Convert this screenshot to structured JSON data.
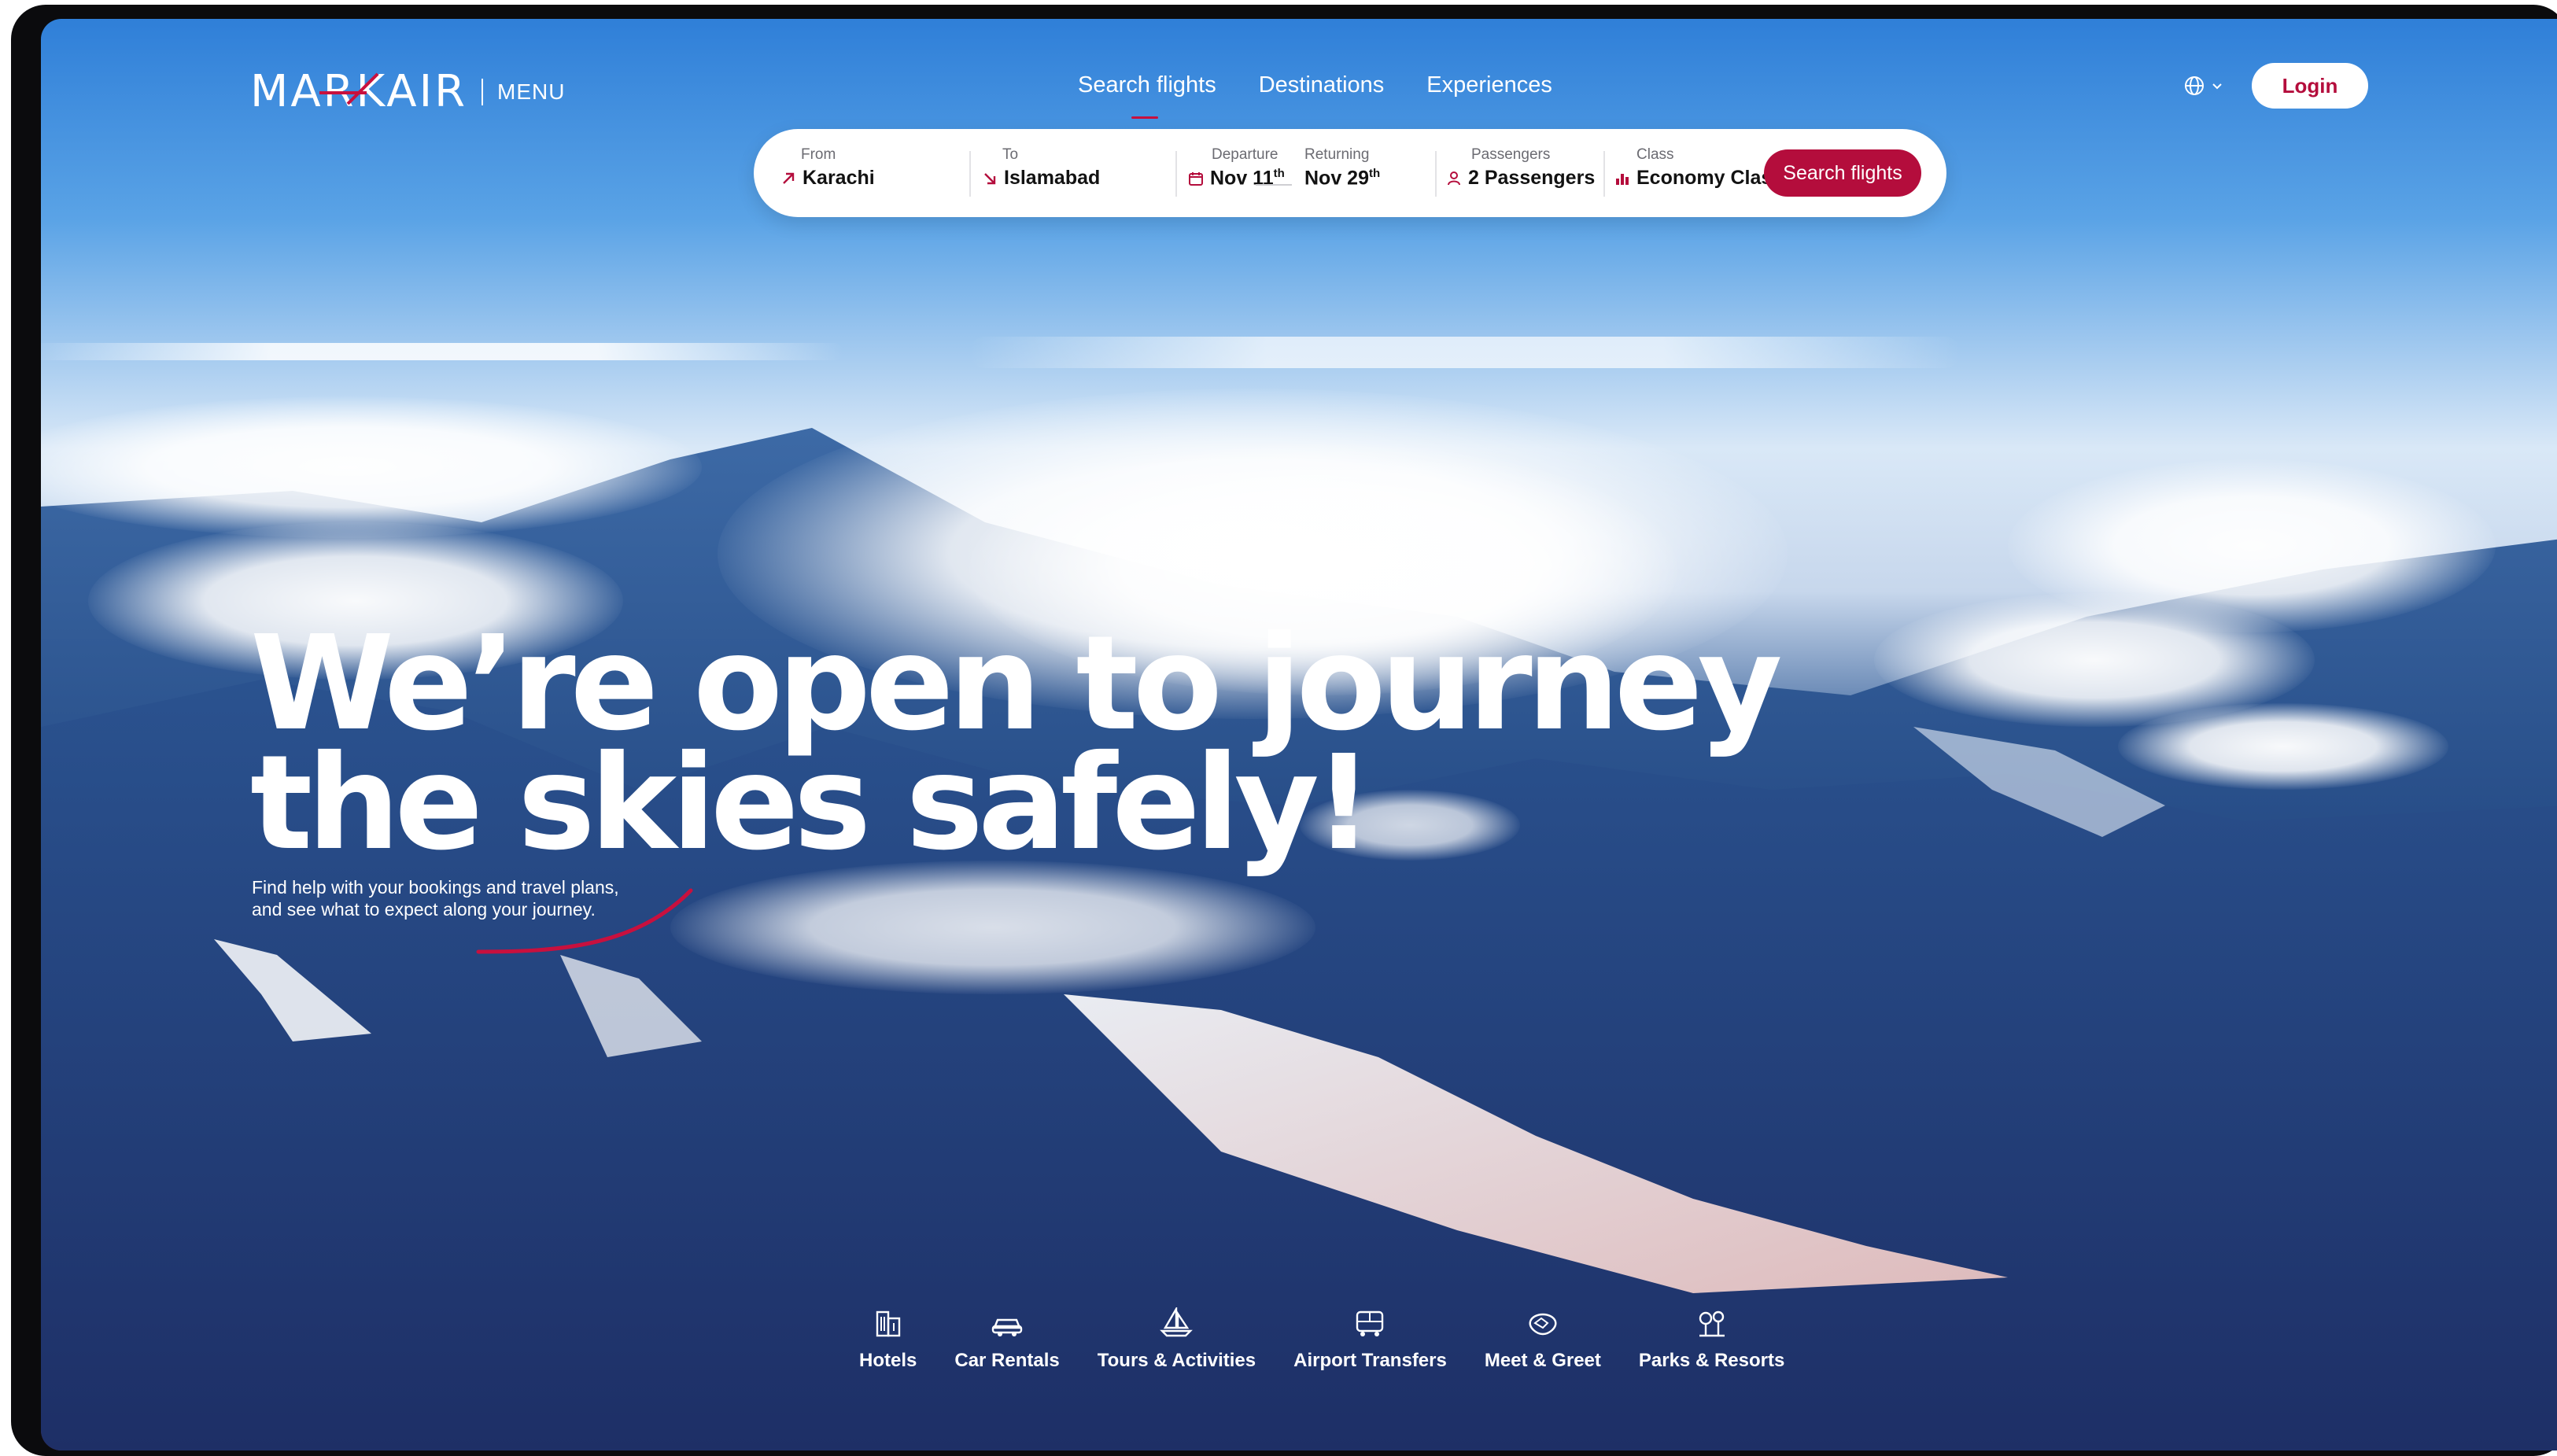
{
  "brand": {
    "logo_text": "MARKAIR",
    "menu_label": "MENU"
  },
  "nav": {
    "items": [
      {
        "label": "Search flights",
        "active": true
      },
      {
        "label": "Destinations",
        "active": false
      },
      {
        "label": "Experiences",
        "active": false
      }
    ],
    "language_icon": "globe-icon",
    "login_label": "Login"
  },
  "search": {
    "from": {
      "label": "From",
      "value": "Karachi",
      "icon": "arrow-up-right-icon"
    },
    "to": {
      "label": "To",
      "value": "Islamabad",
      "icon": "arrow-down-right-icon"
    },
    "departure": {
      "label": "Departure",
      "value": "Nov 11",
      "suffix": "th",
      "icon": "calendar-icon"
    },
    "returning": {
      "label": "Returning",
      "value": "Nov 29",
      "suffix": "th"
    },
    "passengers": {
      "label": "Passengers",
      "value": "2 Passengers",
      "icon": "person-icon"
    },
    "class": {
      "label": "Class",
      "value": "Economy Class",
      "icon": "seat-class-icon"
    },
    "button_label": "Search flights"
  },
  "hero": {
    "title_line1": "We’re open to journey",
    "title_line2": "the skies safely!",
    "subtitle_line1": "Find help with your bookings and travel plans,",
    "subtitle_line2": "and see what to expect along your journey."
  },
  "services": [
    {
      "label": "Hotels",
      "icon": "hotel-icon"
    },
    {
      "label": "Car Rentals",
      "icon": "car-icon"
    },
    {
      "label": "Tours & Activities",
      "icon": "sailboat-icon"
    },
    {
      "label": "Airport Transfers",
      "icon": "bus-icon"
    },
    {
      "label": "Meet & Greet",
      "icon": "handshake-icon"
    },
    {
      "label": "Parks & Resorts",
      "icon": "trees-icon"
    }
  ],
  "colors": {
    "accent": "#b40d3c",
    "white": "#ffffff"
  }
}
